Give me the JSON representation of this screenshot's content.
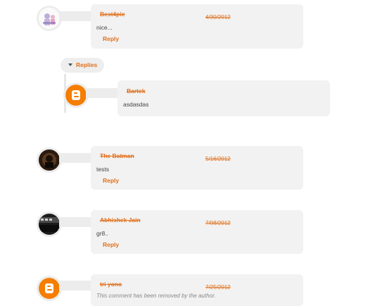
{
  "comments": [
    {
      "author": "Best4pic",
      "date": "4/30/2012",
      "text": "nice...",
      "reply_label": "Reply",
      "avatar": "best4pic-logo"
    },
    {
      "author": "The Batman",
      "date": "5/16/2012",
      "text": "tests",
      "reply_label": "Reply",
      "avatar": "batman-photo"
    },
    {
      "author": "Abhishek Jain",
      "date": "7/08/2012",
      "text": "gr8..",
      "reply_label": "Reply",
      "avatar": "photo"
    },
    {
      "author": "tri yono",
      "date": "7/25/2012",
      "text": "This comment has been removed by the author.",
      "avatar": "blogger-icon"
    }
  ],
  "replies_toggle": {
    "label": "Replies",
    "icon": "caret-down-icon"
  },
  "reply": {
    "author": "Bartek",
    "text": "asdasdas",
    "avatar": "blogger-icon"
  },
  "colors": {
    "accent": "#e0701c",
    "card": "#f2f2f2",
    "blogger": "#f57d00"
  }
}
